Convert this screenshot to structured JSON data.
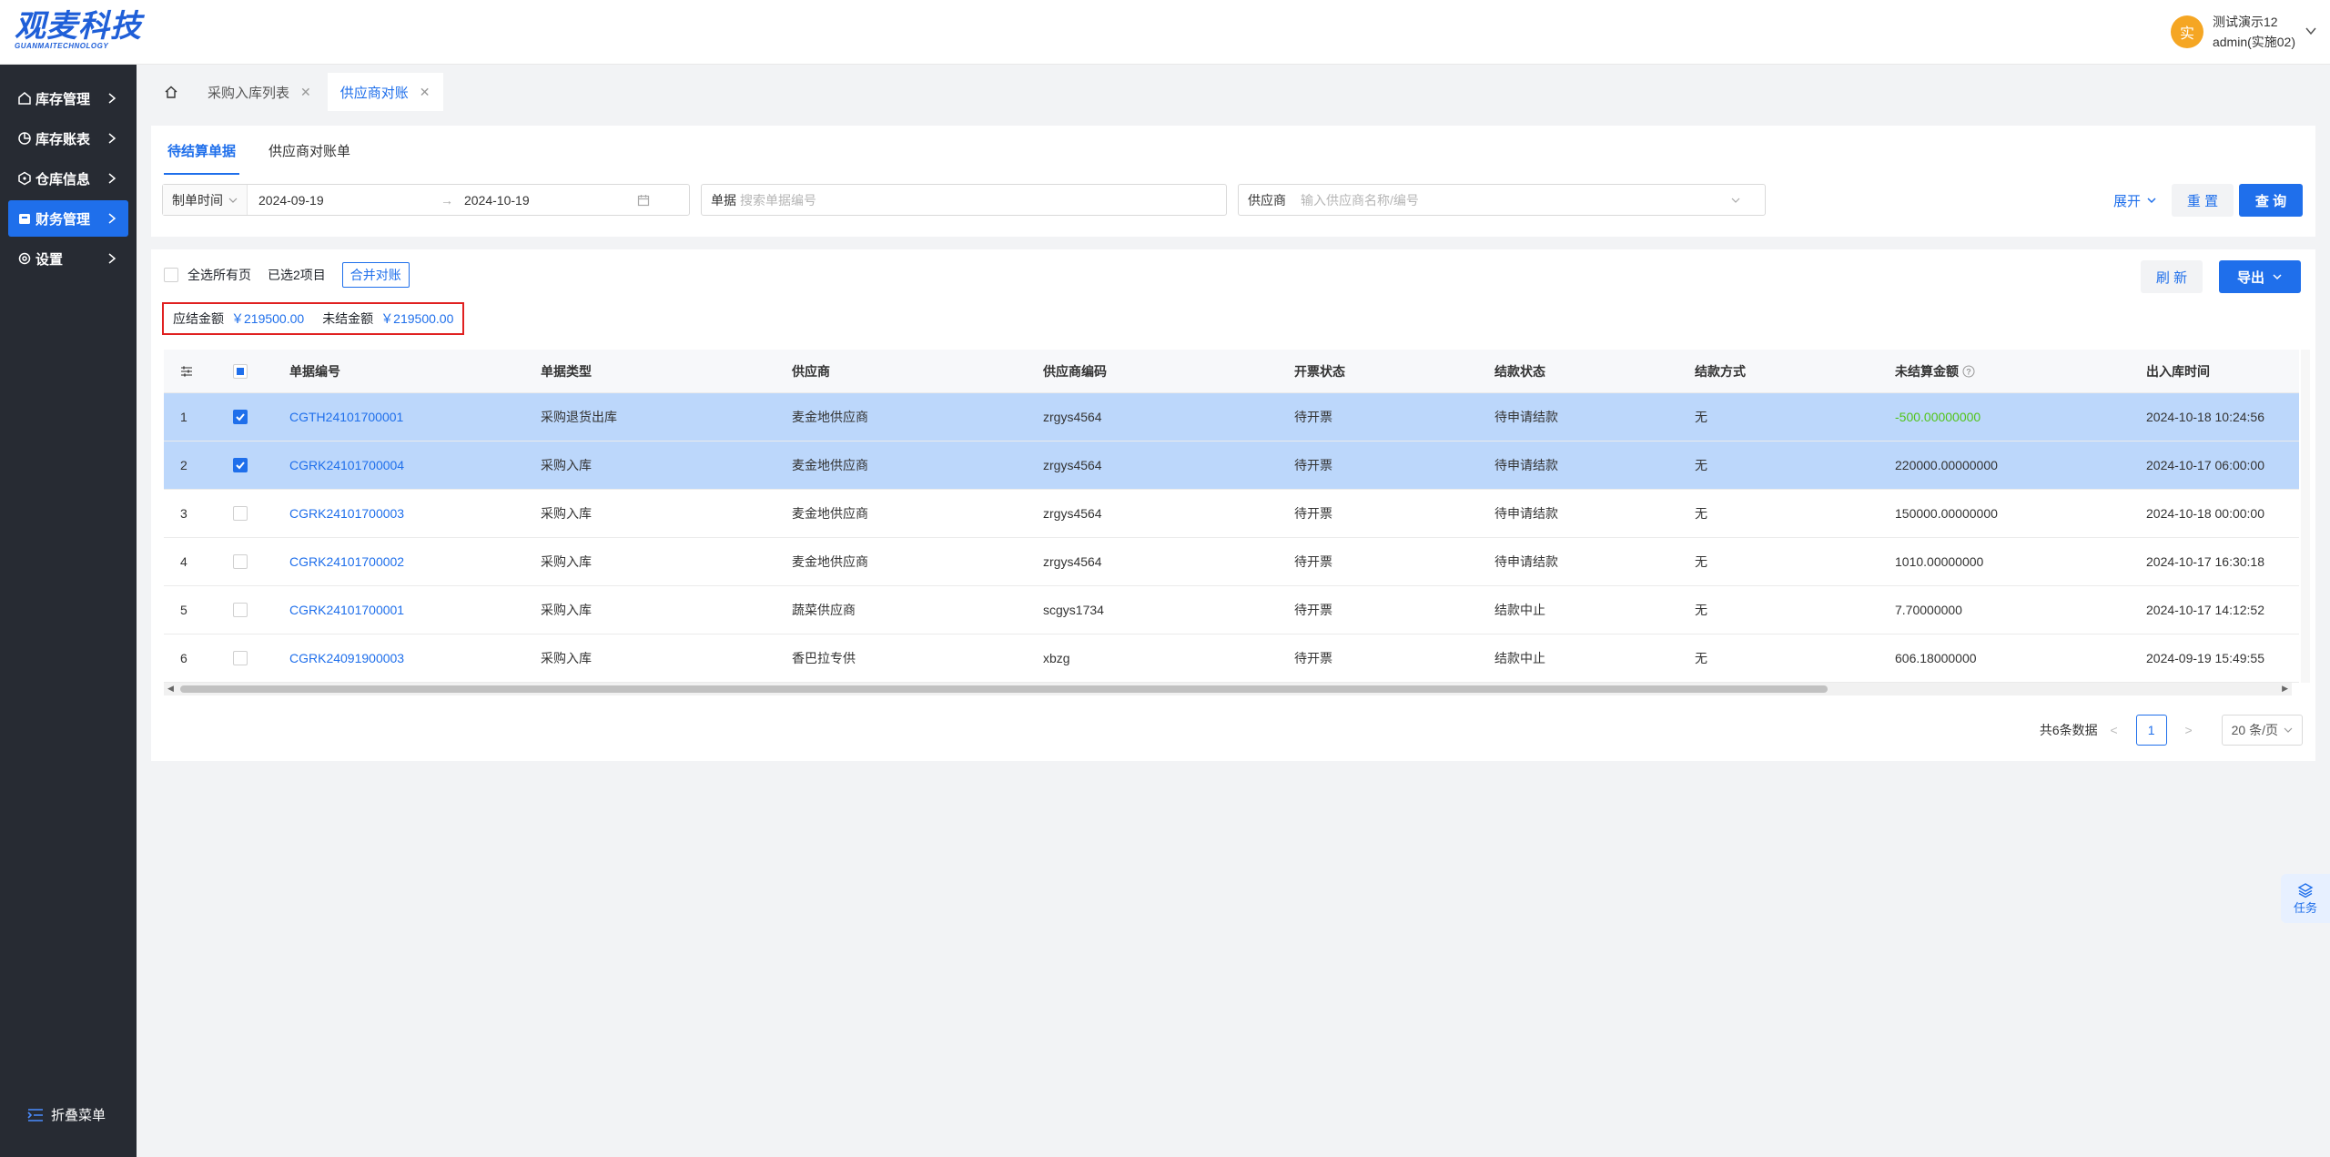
{
  "brand": {
    "name": "观麦科技",
    "sub": "GUANMAITECHNOLOGY",
    "color": "#1f5fd8"
  },
  "user": {
    "avatar_char": "实",
    "name": "测试演示12",
    "account": "admin(实施02)"
  },
  "sidebar": {
    "items": [
      {
        "label": "库存管理",
        "icon": "home-icon",
        "active": false
      },
      {
        "label": "库存账表",
        "icon": "pie-chart-icon",
        "active": false
      },
      {
        "label": "仓库信息",
        "icon": "cube-icon",
        "active": false
      },
      {
        "label": "财务管理",
        "icon": "wallet-icon",
        "active": true
      },
      {
        "label": "设置",
        "icon": "gear-icon",
        "active": false
      }
    ],
    "collapse_label": "折叠菜单"
  },
  "tabs": [
    {
      "label": "采购入库列表",
      "active": false
    },
    {
      "label": "供应商对账",
      "active": true
    }
  ],
  "subtabs": [
    {
      "label": "待结算单据",
      "active": true
    },
    {
      "label": "供应商对账单",
      "active": false
    }
  ],
  "filters": {
    "date_type": "制单时间",
    "start_date": "2024-09-19",
    "end_date": "2024-10-19",
    "doc_label": "单据",
    "doc_placeholder": "搜索单据编号",
    "supplier_label": "供应商",
    "supplier_placeholder": "输入供应商名称/编号",
    "expand_label": "展开",
    "reset_label": "重 置",
    "query_label": "查 询"
  },
  "toolbar": {
    "select_all_pages": "全选所有页",
    "selected_text": "已选2项目",
    "merge_label": "合并对账",
    "refresh_label": "刷 新",
    "export_label": "导出"
  },
  "summary": {
    "payable_label": "应结金额",
    "payable_value": "￥219500.00",
    "unsettled_label": "未结金额",
    "unsettled_value": "￥219500.00"
  },
  "table": {
    "columns": [
      "单据编号",
      "单据类型",
      "供应商",
      "供应商编码",
      "开票状态",
      "结款状态",
      "结款方式",
      "未结算金额",
      "出入库时间"
    ],
    "rows": [
      {
        "idx": "1",
        "checked": true,
        "no": "CGTH24101700001",
        "type": "采购退货出库",
        "supplier": "麦金地供应商",
        "code": "zrgys4564",
        "invoice": "待开票",
        "status": "待申请结款",
        "pay": "无",
        "amount": "-500.00000000",
        "negative": true,
        "time": "2024-10-18 10:24:56"
      },
      {
        "idx": "2",
        "checked": true,
        "no": "CGRK24101700004",
        "type": "采购入库",
        "supplier": "麦金地供应商",
        "code": "zrgys4564",
        "invoice": "待开票",
        "status": "待申请结款",
        "pay": "无",
        "amount": "220000.00000000",
        "negative": false,
        "time": "2024-10-17 06:00:00"
      },
      {
        "idx": "3",
        "checked": false,
        "no": "CGRK24101700003",
        "type": "采购入库",
        "supplier": "麦金地供应商",
        "code": "zrgys4564",
        "invoice": "待开票",
        "status": "待申请结款",
        "pay": "无",
        "amount": "150000.00000000",
        "negative": false,
        "time": "2024-10-18 00:00:00"
      },
      {
        "idx": "4",
        "checked": false,
        "no": "CGRK24101700002",
        "type": "采购入库",
        "supplier": "麦金地供应商",
        "code": "zrgys4564",
        "invoice": "待开票",
        "status": "待申请结款",
        "pay": "无",
        "amount": "1010.00000000",
        "negative": false,
        "time": "2024-10-17 16:30:18"
      },
      {
        "idx": "5",
        "checked": false,
        "no": "CGRK24101700001",
        "type": "采购入库",
        "supplier": "蔬菜供应商",
        "code": "scgys1734",
        "invoice": "待开票",
        "status": "结款中止",
        "pay": "无",
        "amount": "7.70000000",
        "negative": false,
        "time": "2024-10-17 14:12:52"
      },
      {
        "idx": "6",
        "checked": false,
        "no": "CGRK24091900003",
        "type": "采购入库",
        "supplier": "香巴拉专供",
        "code": "xbzg",
        "invoice": "待开票",
        "status": "结款中止",
        "pay": "无",
        "amount": "606.18000000",
        "negative": false,
        "time": "2024-09-19 15:49:55"
      }
    ]
  },
  "pagination": {
    "total_text": "共6条数据",
    "current_page": "1",
    "page_size": "20 条/页"
  },
  "task_button": {
    "label": "任务"
  },
  "colors": {
    "primary": "#1f6feb",
    "sidebar_bg": "#272b33",
    "selected_row": "#bcd7fb",
    "negative_amount": "#52c41a",
    "highlight_border": "#e02020"
  }
}
